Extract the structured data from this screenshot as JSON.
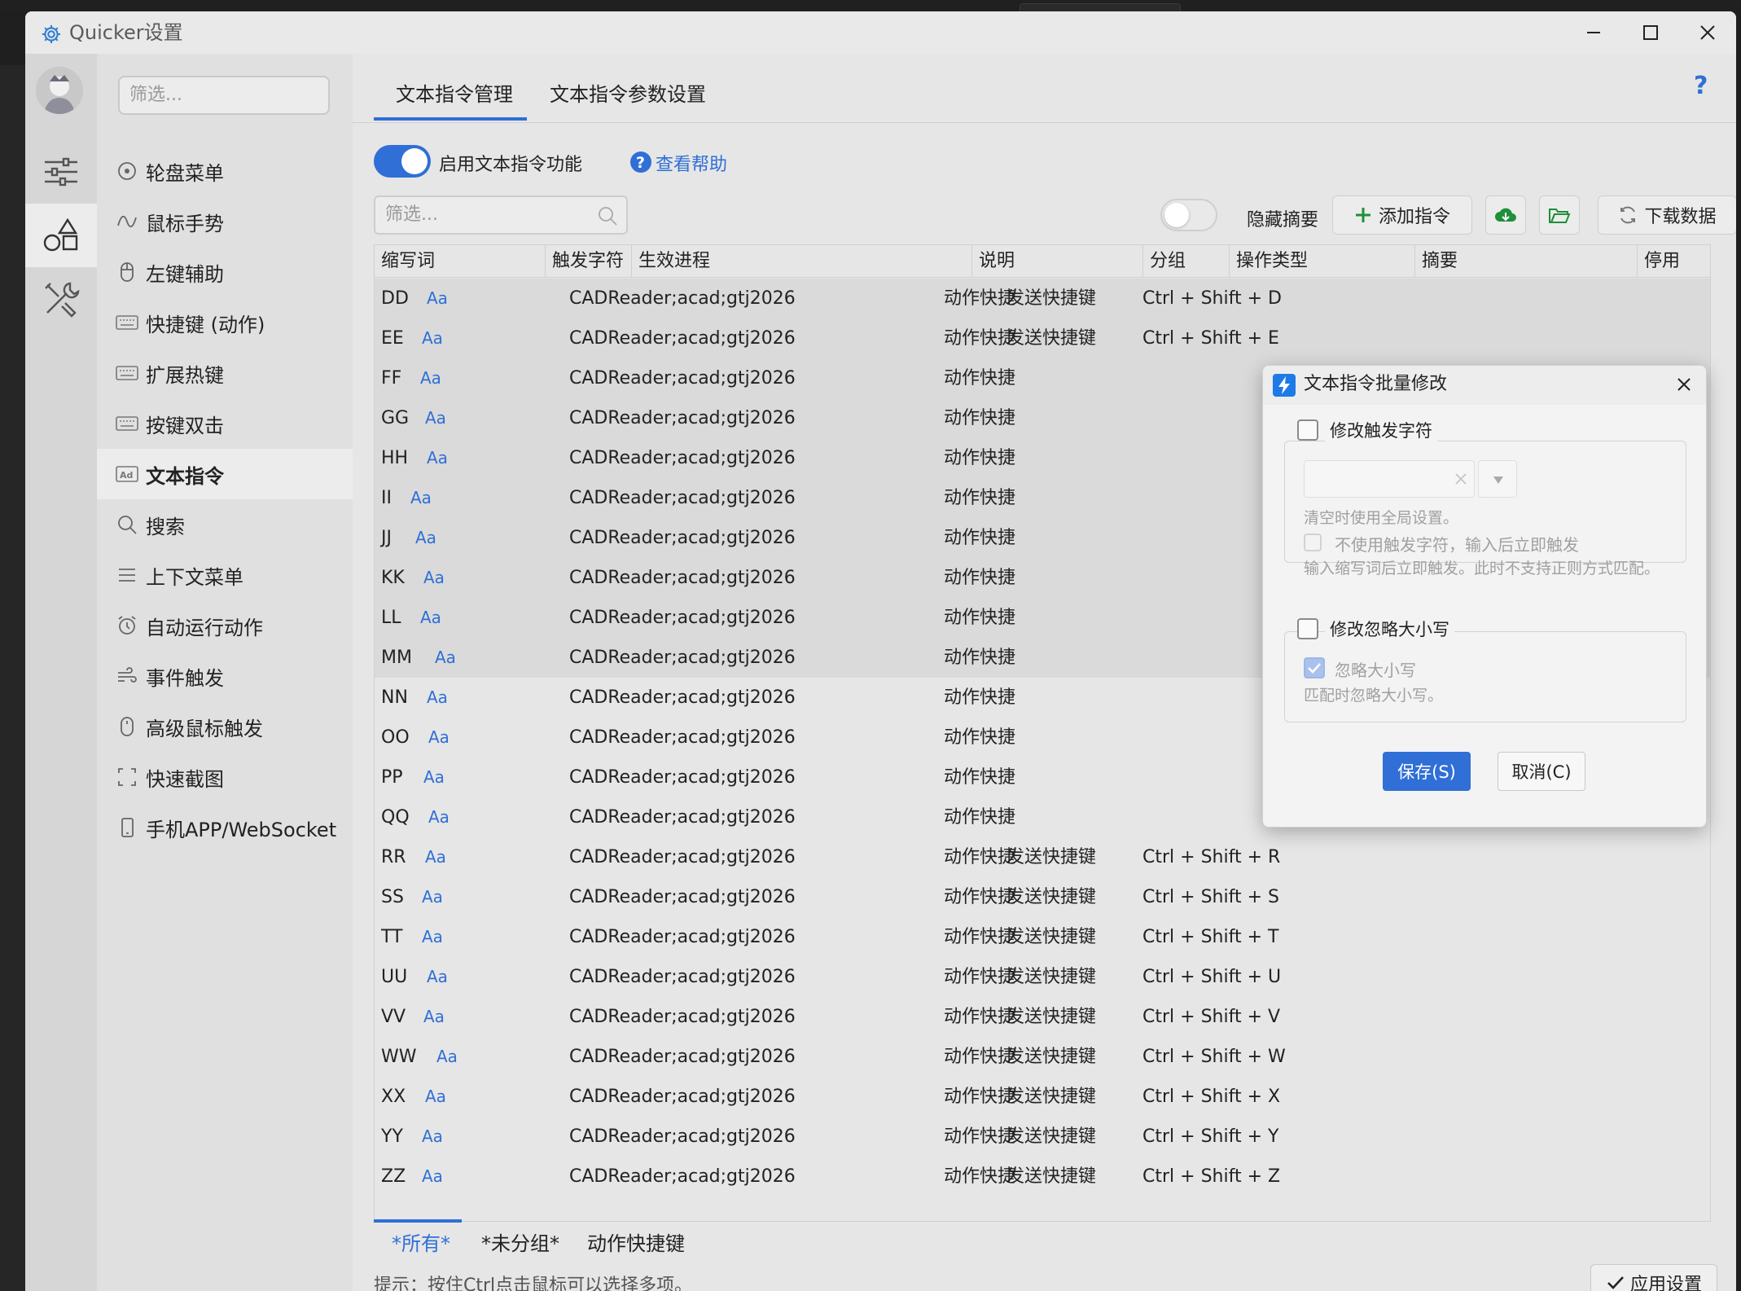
{
  "window": {
    "title": "Quicker设置"
  },
  "nav": {
    "filter_placeholder": "筛选...",
    "items": [
      {
        "label": "轮盘菜单"
      },
      {
        "label": "鼠标手势"
      },
      {
        "label": "左键辅助"
      },
      {
        "label": "快捷键 (动作)"
      },
      {
        "label": "扩展热键"
      },
      {
        "label": "按键双击"
      },
      {
        "label": "文本指令"
      },
      {
        "label": "搜索"
      },
      {
        "label": "上下文菜单"
      },
      {
        "label": "自动运行动作"
      },
      {
        "label": "事件触发"
      },
      {
        "label": "高级鼠标触发"
      },
      {
        "label": "快速截图"
      },
      {
        "label": "手机APP/WebSocket"
      }
    ]
  },
  "tabs": [
    "文本指令管理",
    "文本指令参数设置"
  ],
  "help_q": "?",
  "enable_label": "启用文本指令功能",
  "help_link": "查看帮助",
  "filter_placeholder": "筛选...",
  "hide_summary_label": "隐藏摘要",
  "add_label": "添加指令",
  "download_label": "下载数据",
  "table": {
    "headers": [
      "缩写词",
      "触发字符",
      "生效进程",
      "说明",
      "分组",
      "操作类型",
      "摘要",
      "停用"
    ],
    "case_badge": "Aa",
    "rows": [
      {
        "abbr": "DD",
        "process": "CADReader;acad;gtj2026",
        "group": "动作快捷",
        "op": "发送快捷键",
        "summary": "Ctrl + Shift + D"
      },
      {
        "abbr": "EE",
        "process": "CADReader;acad;gtj2026",
        "group": "动作快捷",
        "op": "发送快捷键",
        "summary": "Ctrl + Shift + E"
      },
      {
        "abbr": "FF",
        "process": "CADReader;acad;gtj2026",
        "group": "动作快捷",
        "op": "",
        "summary": ""
      },
      {
        "abbr": "GG",
        "process": "CADReader;acad;gtj2026",
        "group": "动作快捷",
        "op": "",
        "summary": ""
      },
      {
        "abbr": "HH",
        "process": "CADReader;acad;gtj2026",
        "group": "动作快捷",
        "op": "",
        "summary": ""
      },
      {
        "abbr": "II",
        "process": "CADReader;acad;gtj2026",
        "group": "动作快捷",
        "op": "",
        "summary": ""
      },
      {
        "abbr": "JJ",
        "process": "CADReader;acad;gtj2026",
        "group": "动作快捷",
        "op": "",
        "summary": ""
      },
      {
        "abbr": "KK",
        "process": "CADReader;acad;gtj2026",
        "group": "动作快捷",
        "op": "",
        "summary": ""
      },
      {
        "abbr": "LL",
        "process": "CADReader;acad;gtj2026",
        "group": "动作快捷",
        "op": "",
        "summary": ""
      },
      {
        "abbr": "MM",
        "process": "CADReader;acad;gtj2026",
        "group": "动作快捷",
        "op": "",
        "summary": ""
      },
      {
        "abbr": "NN",
        "process": "CADReader;acad;gtj2026",
        "group": "动作快捷",
        "op": "",
        "summary": ""
      },
      {
        "abbr": "OO",
        "process": "CADReader;acad;gtj2026",
        "group": "动作快捷",
        "op": "",
        "summary": ""
      },
      {
        "abbr": "PP",
        "process": "CADReader;acad;gtj2026",
        "group": "动作快捷",
        "op": "",
        "summary": ""
      },
      {
        "abbr": "QQ",
        "process": "CADReader;acad;gtj2026",
        "group": "动作快捷",
        "op": "",
        "summary": ""
      },
      {
        "abbr": "RR",
        "process": "CADReader;acad;gtj2026",
        "group": "动作快捷",
        "op": "发送快捷键",
        "summary": "Ctrl + Shift + R"
      },
      {
        "abbr": "SS",
        "process": "CADReader;acad;gtj2026",
        "group": "动作快捷",
        "op": "发送快捷键",
        "summary": "Ctrl + Shift + S"
      },
      {
        "abbr": "TT",
        "process": "CADReader;acad;gtj2026",
        "group": "动作快捷",
        "op": "发送快捷键",
        "summary": "Ctrl + Shift + T"
      },
      {
        "abbr": "UU",
        "process": "CADReader;acad;gtj2026",
        "group": "动作快捷",
        "op": "发送快捷键",
        "summary": "Ctrl + Shift + U"
      },
      {
        "abbr": "VV",
        "process": "CADReader;acad;gtj2026",
        "group": "动作快捷",
        "op": "发送快捷键",
        "summary": "Ctrl + Shift + V"
      },
      {
        "abbr": "WW",
        "process": "CADReader;acad;gtj2026",
        "group": "动作快捷",
        "op": "发送快捷键",
        "summary": "Ctrl + Shift + W"
      },
      {
        "abbr": "XX",
        "process": "CADReader;acad;gtj2026",
        "group": "动作快捷",
        "op": "发送快捷键",
        "summary": "Ctrl + Shift + X"
      },
      {
        "abbr": "YY",
        "process": "CADReader;acad;gtj2026",
        "group": "动作快捷",
        "op": "发送快捷键",
        "summary": "Ctrl + Shift + Y"
      },
      {
        "abbr": "ZZ",
        "process": "CADReader;acad;gtj2026",
        "group": "动作快捷",
        "op": "发送快捷键",
        "summary": "Ctrl + Shift + Z"
      }
    ]
  },
  "bottom_tabs": [
    "*所有*",
    "*未分组*",
    "动作快捷键"
  ],
  "hint": "提示：按住Ctrl点击鼠标可以选择多项。",
  "apply_label": "应用设置",
  "dialog": {
    "title": "文本指令批量修改",
    "group1_title": "修改触发字符",
    "clear_hint": "清空时使用全局设置。",
    "no_trigger_label": "不使用触发字符，输入后立即触发",
    "no_trigger_desc": "输入缩写词后立即触发。此时不支持正则方式匹配。",
    "group2_title": "修改忽略大小写",
    "ignore_case_label": "忽略大小写",
    "ignore_case_desc": "匹配时忽略大小写。",
    "save_label": "保存(S)",
    "cancel_label": "取消(C)"
  }
}
